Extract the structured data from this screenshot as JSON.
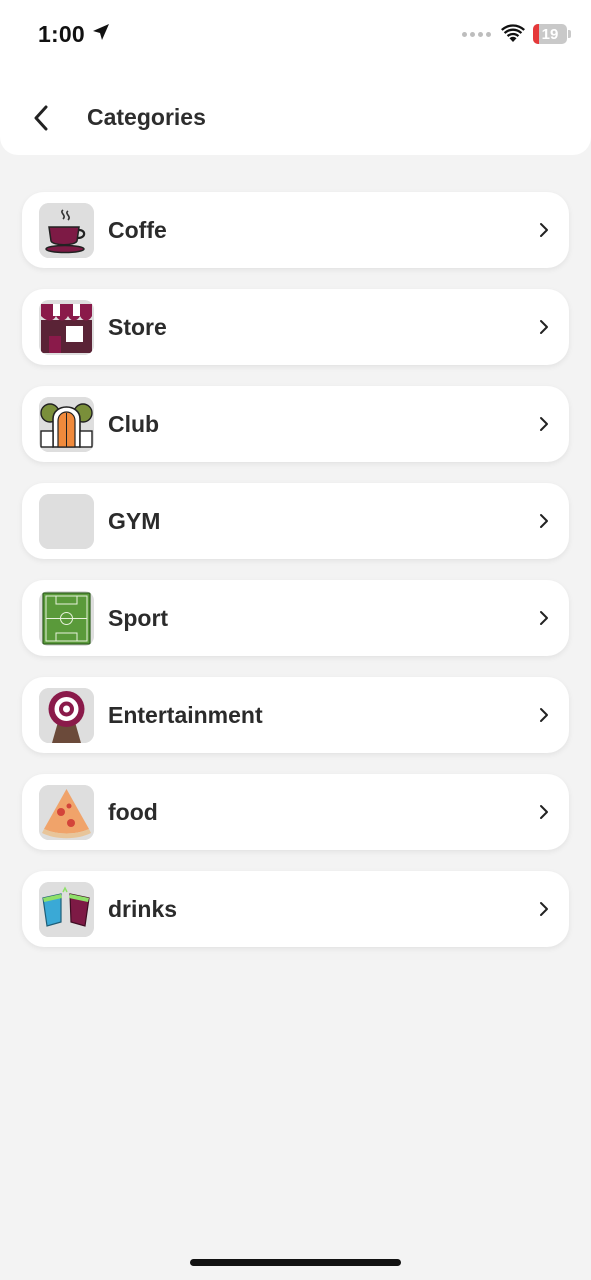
{
  "status_bar": {
    "time": "1:00",
    "battery": "19",
    "icons": [
      "location-arrow-icon",
      "cellular-signal-icon",
      "wifi-icon",
      "battery-icon"
    ]
  },
  "header": {
    "title": "Categories",
    "back_icon": "chevron-left-icon"
  },
  "categories": [
    {
      "label": "Coffe",
      "icon": "coffee-cup-icon"
    },
    {
      "label": "Store",
      "icon": "storefront-icon"
    },
    {
      "label": "Club",
      "icon": "club-arch-icon"
    },
    {
      "label": "GYM",
      "icon": "placeholder-icon"
    },
    {
      "label": "Sport",
      "icon": "soccer-field-icon"
    },
    {
      "label": "Entertainment",
      "icon": "target-icon"
    },
    {
      "label": "food",
      "icon": "pizza-slice-icon"
    },
    {
      "label": "drinks",
      "icon": "drink-cups-icon"
    }
  ],
  "colors": {
    "background": "#f3f3f3",
    "card": "#ffffff",
    "accent": "#8a1a4a",
    "text": "#2b2b2b"
  }
}
